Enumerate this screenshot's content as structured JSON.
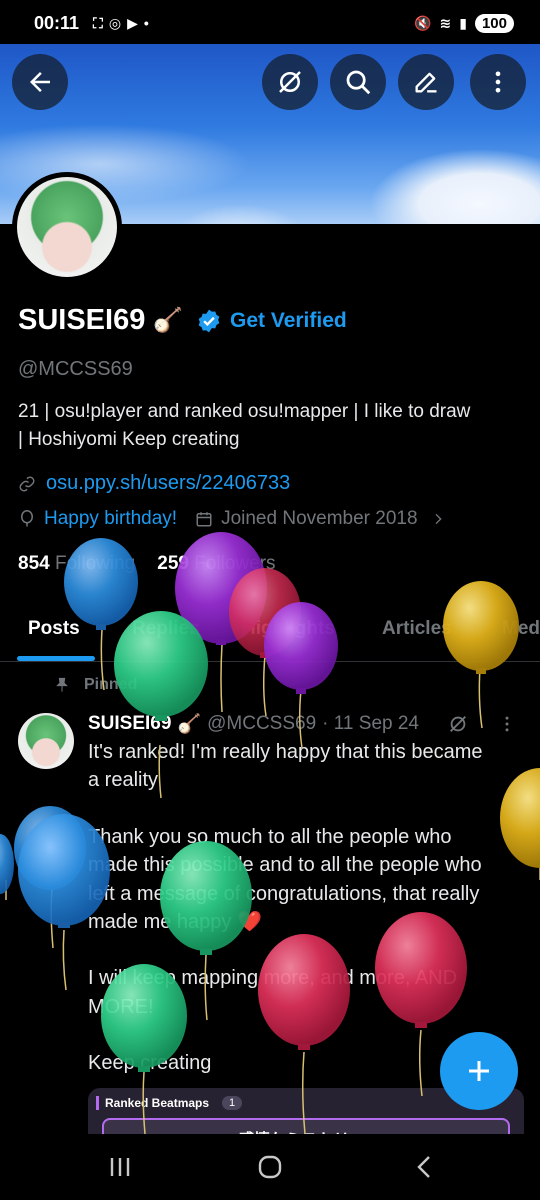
{
  "status_bar": {
    "time": "00:11",
    "battery": "100"
  },
  "profile": {
    "name": "SUISEI69",
    "name_emoji": "🪕",
    "get_verified": "Get Verified",
    "handle": "@MCCSS69",
    "bio_line1": "21 | osu!player and ranked osu!mapper | I like to draw",
    "bio_line2": "| Hoshiyomi  Keep creating",
    "link": "osu.ppy.sh/users/22406733",
    "birthday": "Happy birthday!",
    "joined": "Joined November 2018",
    "following_count": "854",
    "following_label": "Following",
    "followers_count": "259",
    "followers_label": "Followers"
  },
  "tabs": [
    "Posts",
    "Replies",
    "Highlights",
    "Articles",
    "Med"
  ],
  "pinned_label": "Pinned",
  "post": {
    "author": "SUISEI69",
    "author_emoji": "🪕",
    "handle": "@MCCSS69",
    "date": "· 11 Sep 24",
    "lines": [
      "It's ranked! I'm really happy that this became",
      "a reality",
      "",
      "Thank you so much to all the people who",
      "made this possible and to all the people who",
      "left a message of congratulations, that really",
      "made me happy ❤️",
      "",
      "I will keep mapping more, and more, AND",
      "MORE!",
      "",
      "Keep creating"
    ],
    "card_tag": "Ranked Beatmaps",
    "card_count": "1",
    "card_title": "感情ケミストリー"
  },
  "colors": {
    "accent": "#1d9bf0",
    "balloon_blue": "#2d8fe0",
    "balloon_purple": "#9a2fd6",
    "balloon_green": "#2fd08a",
    "balloon_red": "#e0315a",
    "balloon_yellow": "#e0b11a"
  }
}
